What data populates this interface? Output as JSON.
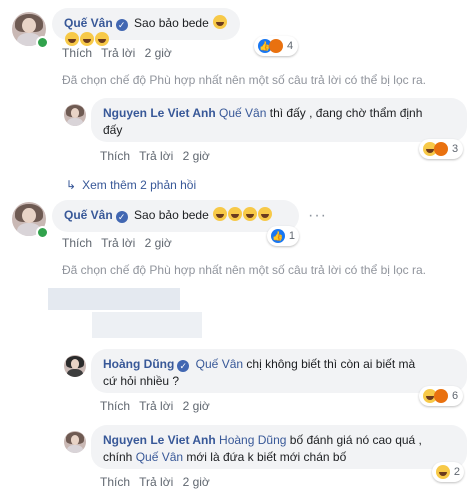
{
  "comments": [
    {
      "author": "Quế Vân",
      "text": "Sao bảo bede",
      "like_label": "Thích",
      "reply_label": "Trả lời",
      "time": "2 giờ",
      "reaction_count": "4"
    },
    {
      "author": "Nguyen Le Viet Anh",
      "mention": "Quế Vân",
      "text_line1": "thì đấy , đang chờ thẩm định",
      "text_line2": "đấy",
      "like_label": "Thích",
      "reply_label": "Trả lời",
      "time": "2 giờ",
      "reaction_count": "3"
    },
    {
      "author": "Quế Vân",
      "text": "Sao bảo bede",
      "like_label": "Thích",
      "reply_label": "Trả lời",
      "time": "2 giờ",
      "reaction_count": "1"
    },
    {
      "author": "Hoàng Dũng",
      "mention": "Quế Vân",
      "text_line1": "chị không biết thì còn ai biết mà",
      "text_line2": "cứ hỏi nhiều ?",
      "like_label": "Thích",
      "reply_label": "Trả lời",
      "time": "2 giờ",
      "reaction_count": "6"
    },
    {
      "author": "Nguyen Le Viet Anh",
      "mention": "Hoàng Dũng",
      "text_line1": "bố đánh giá nó cao quá ,",
      "text_line2_pre": "chính",
      "mention2": "Quế Vân",
      "text_line2_post": "mới là đứa k biết mới chán bố",
      "like_label": "Thích",
      "reply_label": "Trả lời",
      "time": "2 giờ",
      "reaction_count": "2"
    }
  ],
  "filter_notice": "Đã chọn chế độ Phù hợp nhất nên một số câu trả lời có thể bị lọc ra.",
  "view_more_replies": "Xem thêm 2 phản hồi",
  "more_options": "···",
  "colors": {
    "link": "#385898",
    "bubble": "#f2f3f5",
    "meta": "#606770",
    "like_blue": "#1877f2"
  }
}
